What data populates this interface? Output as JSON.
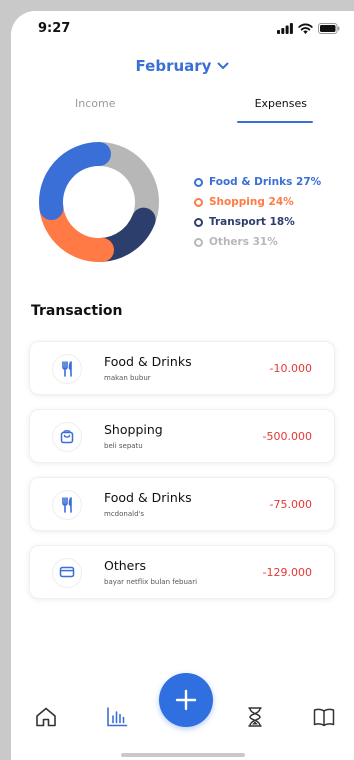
{
  "status_bar": {
    "time": "9:27"
  },
  "header": {
    "month": "February"
  },
  "tabs": [
    {
      "label": "Income",
      "active": false
    },
    {
      "label": "Expenses",
      "active": true
    }
  ],
  "chart_data": {
    "type": "pie",
    "categories": [
      "Food & Drinks",
      "Shopping",
      "Transport",
      "Others"
    ],
    "values": [
      27,
      24,
      18,
      31
    ],
    "colors": [
      "#3a6fd8",
      "#ff7a45",
      "#2c3e6b",
      "#b7b7b7"
    ],
    "legend": [
      "Food & Drinks 27%",
      "Shopping 24%",
      "Transport 18%",
      "Others 31%"
    ]
  },
  "transactions": {
    "title": "Transaction",
    "items": [
      {
        "title": "Food & Drinks",
        "subtitle": "makan bubur",
        "amount": "-10.000",
        "icon": "fork-knife-icon"
      },
      {
        "title": "Shopping",
        "subtitle": "beli sepatu",
        "amount": "-500.000",
        "icon": "shopping-bag-icon"
      },
      {
        "title": "Food & Drinks",
        "subtitle": "mcdonald's",
        "amount": "-75.000",
        "icon": "fork-knife-icon"
      },
      {
        "title": "Others",
        "subtitle": "bayar netflix bulan febuari",
        "amount": "-129.000",
        "icon": "card-icon"
      }
    ]
  },
  "bottom_nav": [
    "home-icon",
    "bar-chart-icon",
    "add-icon",
    "hourglass-icon",
    "book-icon"
  ]
}
